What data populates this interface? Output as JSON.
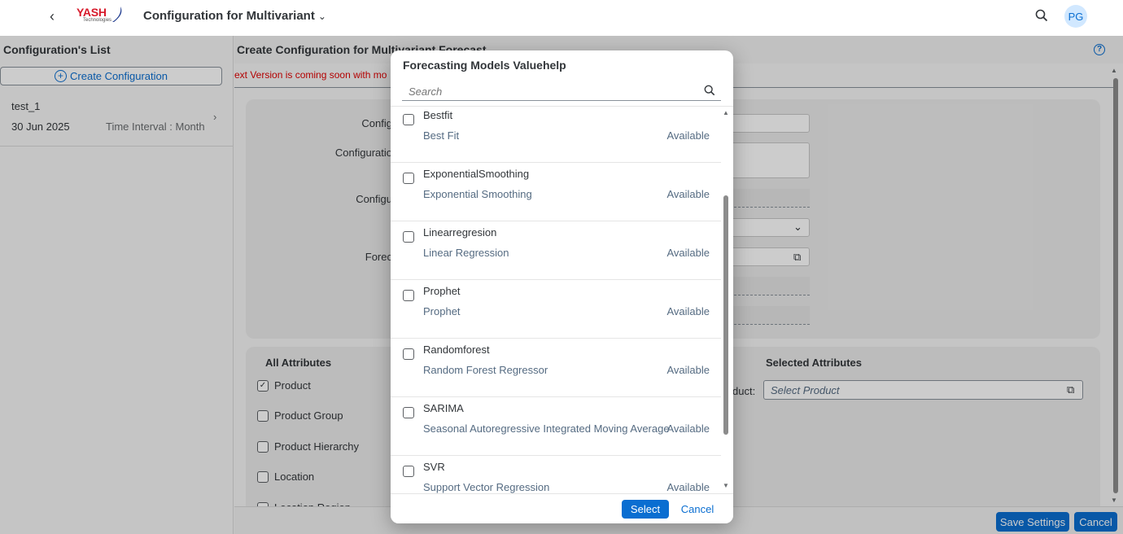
{
  "shell": {
    "logo_text": "YASH",
    "logo_sub": "Technologies",
    "app_title": "Configuration for Multivariant",
    "avatar_initials": "PG"
  },
  "master": {
    "title": "Configuration's List",
    "create_label": "Create Configuration",
    "items": [
      {
        "name": "test_1",
        "date": "30 Jun 2025",
        "interval": "Time Interval : Month"
      }
    ]
  },
  "detail": {
    "title": "Create Configuration for Multivariant Forecast",
    "warning": "ext Version is coming soon with mo",
    "labels": {
      "l1": "Config",
      "l2": "Configuratio",
      "l3": "Configu",
      "l4": "Forec"
    },
    "all_attributes_title": "All Attributes",
    "selected_attributes_title": "Selected Attributes",
    "attributes": [
      {
        "label": "Product",
        "checked": true
      },
      {
        "label": "Product Group",
        "checked": false
      },
      {
        "label": "Product Hierarchy",
        "checked": false
      },
      {
        "label": "Location",
        "checked": false
      },
      {
        "label": "Location Region",
        "checked": false
      }
    ],
    "product_label": "duct:",
    "product_placeholder": "Select Product",
    "save_label": "Save Settings",
    "cancel_label": "Cancel"
  },
  "dialog": {
    "title": "Forecasting Models Valuehelp",
    "search_placeholder": "Search",
    "models": [
      {
        "name": "Bestfit",
        "desc": "Best Fit",
        "status": "Available"
      },
      {
        "name": "ExponentialSmoothing",
        "desc": "Exponential Smoothing",
        "status": "Available"
      },
      {
        "name": "Linearregresion",
        "desc": "Linear Regression",
        "status": "Available"
      },
      {
        "name": "Prophet",
        "desc": "Prophet",
        "status": "Available"
      },
      {
        "name": "Randomforest",
        "desc": "Random Forest Regressor",
        "status": "Available"
      },
      {
        "name": "SARIMA",
        "desc": "Seasonal Autoregressive Integrated Moving Average",
        "status": "Available"
      },
      {
        "name": "SVR",
        "desc": "Support Vector Regression",
        "status": "Available"
      }
    ],
    "select_label": "Select",
    "cancel_label": "Cancel"
  },
  "colors": {
    "accent": "#0a6ed1",
    "brand_red": "#d7192a",
    "warning": "#e00000"
  }
}
